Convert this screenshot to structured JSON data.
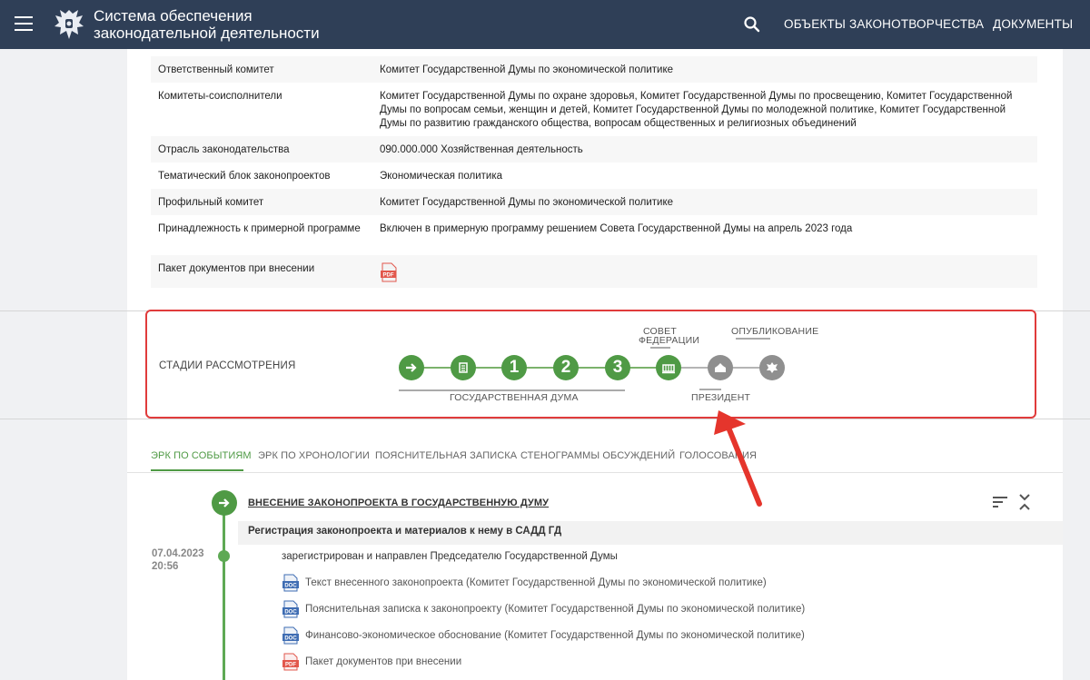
{
  "header": {
    "title_line1": "Система обеспечения",
    "title_line2": "законодательной деятельности",
    "nav": [
      "ОБЪЕКТЫ ЗАКОНОТВОРЧЕСТВА",
      "ДОКУМЕНТЫ"
    ]
  },
  "properties": [
    {
      "label": "Ответственный комитет",
      "value": "Комитет Государственной Думы по экономической политике"
    },
    {
      "label": "Комитеты-соисполнители",
      "value": "Комитет Государственной Думы по охране здоровья, Комитет Государственной Думы по просвещению, Комитет Государственной Думы по вопросам семьи, женщин и детей, Комитет Государственной Думы по молодежной политике, Комитет Государственной Думы по развитию гражданского общества, вопросам общественных и религиозных объединений"
    },
    {
      "label": "Отрасль законодательства",
      "value": "090.000.000 Хозяйственная деятельность"
    },
    {
      "label": "Тематический блок законопроектов",
      "value": "Экономическая политика"
    },
    {
      "label": "Профильный комитет",
      "value": "Комитет Государственной Думы по экономической политике"
    },
    {
      "label": "Принадлежность к примерной программе",
      "value": "Включен в примерную программу решением Совета Государственной Думы на апрель 2023 года"
    },
    {
      "label": "Пакет документов при внесении",
      "value": ""
    }
  ],
  "stages": {
    "label": "СТАДИИ РАССМОТРЕНИЯ",
    "nodes": [
      "",
      "",
      "1",
      "2",
      "3",
      "",
      "",
      ""
    ],
    "caption_duma": "ГОСУДАРСТВЕННАЯ ДУМА",
    "caption_federation_1": "СОВЕТ",
    "caption_federation_2": "ФЕДЕРАЦИИ",
    "caption_president": "ПРЕЗИДЕНТ",
    "caption_publish": "ОПУБЛИКОВАНИЕ"
  },
  "tabs": [
    "ЭРК ПО СОБЫТИЯМ",
    "ЭРК ПО ХРОНОЛОГИИ",
    "ПОЯСНИТЕЛЬНАЯ ЗАПИСКА",
    "СТЕНОГРАММЫ ОБСУЖДЕНИЙ",
    "ГОЛОСОВАНИЯ"
  ],
  "timeline": {
    "event_title": "ВНЕСЕНИЕ ЗАКОНОПРОЕКТА В ГОСУДАРСТВЕННУЮ ДУМУ",
    "sub_title": "Регистрация законопроекта и материалов к нему в САДД ГД",
    "date": "07.04.2023",
    "time": "20:56",
    "event_text": "зарегистрирован и направлен Председателю Государственной Думы",
    "documents": [
      {
        "type": "DOC",
        "label": "Текст внесенного законопроекта (Комитет Государственной Думы по экономической политике)"
      },
      {
        "type": "DOC",
        "label": "Пояснительная записка к законопроекту (Комитет Государственной Думы по экономической политике)"
      },
      {
        "type": "DOC",
        "label": "Финансово-экономическое обоснование (Комитет Государственной Думы по экономической политике)"
      },
      {
        "type": "PDF",
        "label": "Пакет документов при внесении"
      }
    ]
  },
  "colors": {
    "header": "#2f3f57",
    "accent": "#4f9a45",
    "highlight": "#e03b3b",
    "doc": "#3f6db3",
    "pdf": "#e2574c"
  }
}
